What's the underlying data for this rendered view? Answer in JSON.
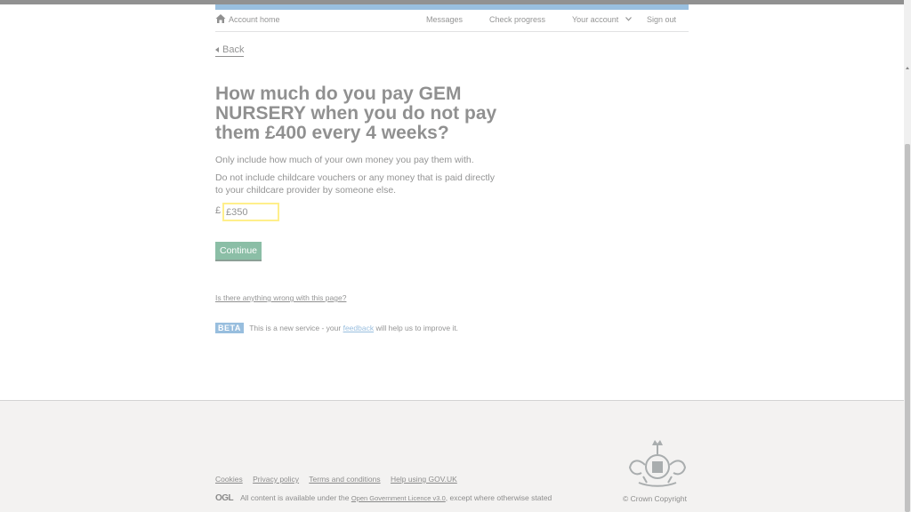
{
  "header": {
    "nav": {
      "home": "Account home",
      "messages": "Messages",
      "check_progress": "Check progress",
      "your_account": "Your account",
      "sign_out": "Sign out"
    }
  },
  "main": {
    "back_link": "Back",
    "heading": "How much do you pay GEM NURSERY when you do not pay them £400 every 4 weeks?",
    "hint1": "Only include how much of your own money you pay them with.",
    "hint2": "Do not include childcare vouchers or any money that is paid directly to your childcare provider by someone else.",
    "currency_symbol": "£",
    "amount_value": "£350",
    "continue_label": "Continue",
    "report_link": "Is there anything wrong with this page?"
  },
  "beta_banner": {
    "tag": "BETA",
    "text_before": "This is a new service - your",
    "link": "feedback",
    "text_after": "will help us to improve it."
  },
  "footer": {
    "links": [
      "Cookies",
      "Privacy policy",
      "Terms and conditions",
      "Help using GOV.UK"
    ],
    "ogl_logo": "OGL",
    "licence_before": "All content is available under the",
    "licence_link": "Open Government Licence v3.0",
    "licence_after": ", except where otherwise stated",
    "copyright": "© Crown Copyright"
  }
}
